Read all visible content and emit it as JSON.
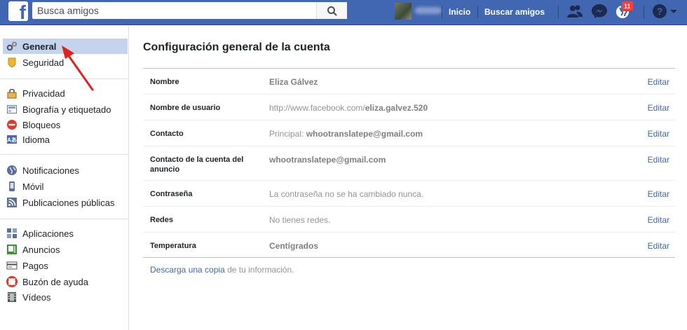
{
  "topbar": {
    "logo_letter": "f",
    "search_placeholder": "Busca amigos",
    "nav_home": "Inicio",
    "nav_find_friends": "Buscar amigos",
    "notifications_count": "11"
  },
  "sidebar": {
    "groups": [
      [
        {
          "label": "General",
          "icon": "gears-icon",
          "selected": true
        },
        {
          "label": "Seguridad",
          "icon": "shield-badge-icon"
        }
      ],
      [
        {
          "label": "Privacidad",
          "icon": "lock-icon"
        },
        {
          "label": "Biografía y etiquetado",
          "icon": "timeline-icon"
        },
        {
          "label": "Bloqueos",
          "icon": "block-icon"
        },
        {
          "label": "Idioma",
          "icon": "language-icon"
        }
      ],
      [
        {
          "label": "Notificaciones",
          "icon": "globe-icon"
        },
        {
          "label": "Móvil",
          "icon": "mobile-icon"
        },
        {
          "label": "Publicaciones públicas",
          "icon": "rss-icon"
        }
      ],
      [
        {
          "label": "Aplicaciones",
          "icon": "apps-icon"
        },
        {
          "label": "Anuncios",
          "icon": "ads-icon"
        },
        {
          "label": "Pagos",
          "icon": "credit-card-icon"
        },
        {
          "label": "Buzón de ayuda",
          "icon": "lifebuoy-icon"
        },
        {
          "label": "Vídeos",
          "icon": "film-icon"
        }
      ]
    ]
  },
  "main": {
    "title": "Configuración general de la cuenta",
    "edit_label": "Editar",
    "rows": [
      {
        "label": "Nombre",
        "value_bold": "Eliza Gálvez",
        "value_plain": ""
      },
      {
        "label": "Nombre de usuario",
        "value_plain": "http://www.facebook.com/",
        "value_bold": "eliza.galvez.520"
      },
      {
        "label": "Contacto",
        "value_plain": "Principal: ",
        "value_bold": "whootranslatepe@gmail.com"
      },
      {
        "label": "Contacto de la cuenta del anuncio",
        "value_plain": "",
        "value_bold": "whootranslatepe@gmail.com"
      },
      {
        "label": "Contraseña",
        "value_plain": "La contraseña no se ha cambiado nunca.",
        "value_bold": ""
      },
      {
        "label": "Redes",
        "value_plain": "No tienes redes.",
        "value_bold": ""
      },
      {
        "label": "Temperatura",
        "value_plain": "",
        "value_bold": "Centígrados"
      }
    ],
    "footer": {
      "link1": "Descarga",
      "text1": " ",
      "link2": "una copia",
      "text2": " de tu información."
    }
  },
  "colors": {
    "brand": "#4267b2",
    "selected_bg": "#c5d3ec",
    "badge": "#fa3e3e",
    "arrow": "#e0201c"
  }
}
